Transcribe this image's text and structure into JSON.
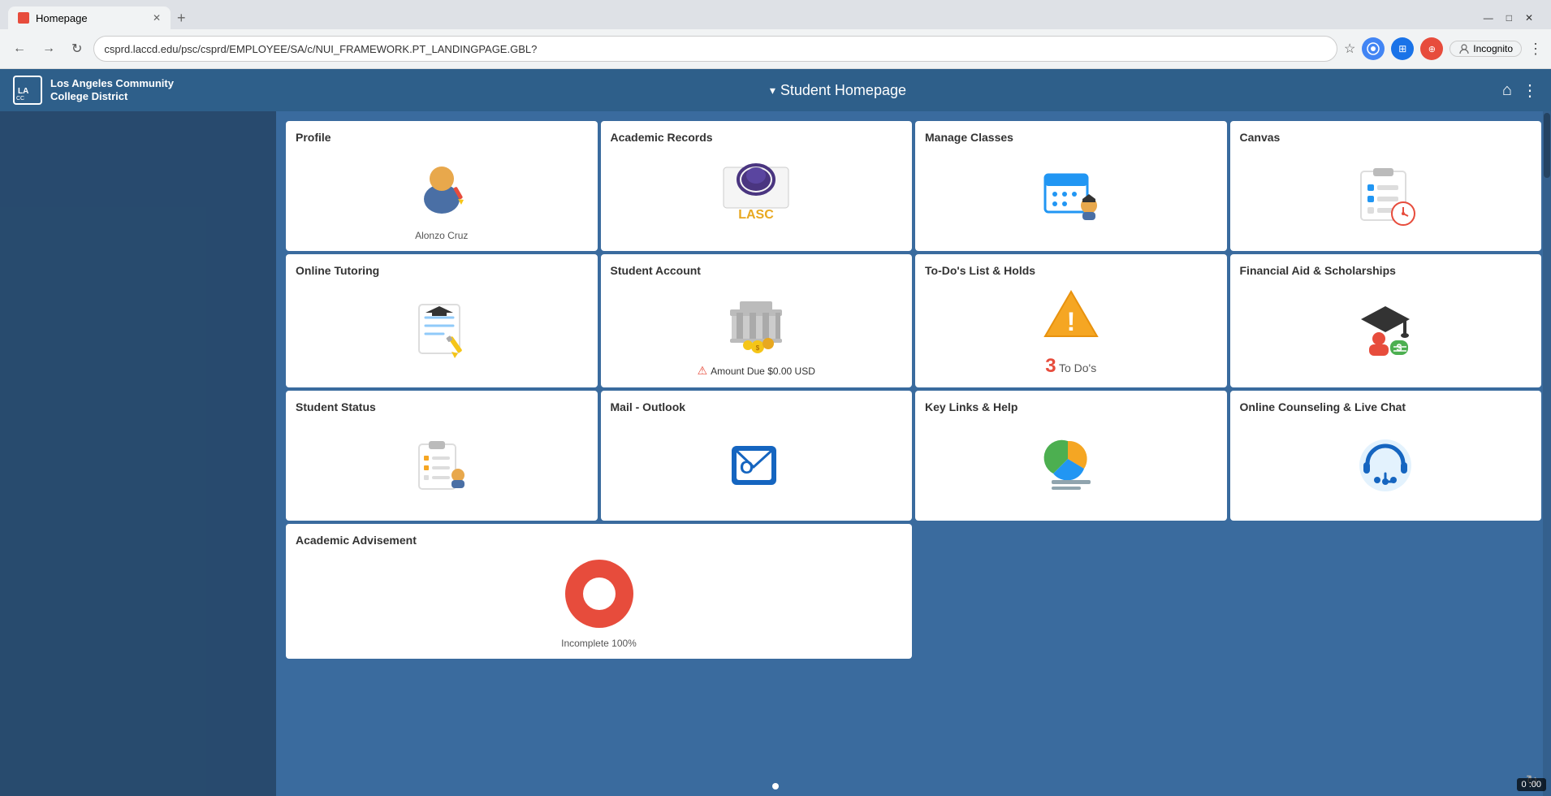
{
  "browser": {
    "tab_label": "Homepage",
    "tab_favicon": "red-square",
    "address_url": "csprd.laccd.edu/psc/csprd/EMPLOYEE/SA/c/NUI_FRAMEWORK.PT_LANDINGPAGE.GBL?",
    "new_tab_label": "+",
    "window_minimize": "—",
    "window_maximize": "□",
    "window_close": "✕",
    "incognito_label": "Incognito",
    "back_btn": "←",
    "forward_btn": "→",
    "refresh_btn": "↻"
  },
  "app_header": {
    "logo_line1": "Los Angeles Community",
    "logo_line2": "College District",
    "title_arrow": "▾",
    "title": "Student Homepage",
    "home_icon": "⌂",
    "menu_icon": "⋮"
  },
  "tiles": [
    {
      "id": "profile",
      "title": "Profile",
      "subtitle": "Alonzo Cruz",
      "icon_type": "profile"
    },
    {
      "id": "academic-records",
      "title": "Academic Records",
      "subtitle": "",
      "icon_type": "lasc"
    },
    {
      "id": "manage-classes",
      "title": "Manage Classes",
      "subtitle": "",
      "icon_type": "calendar"
    },
    {
      "id": "canvas",
      "title": "Canvas",
      "subtitle": "",
      "icon_type": "canvas"
    },
    {
      "id": "online-tutoring",
      "title": "Online Tutoring",
      "subtitle": "",
      "icon_type": "tutoring"
    },
    {
      "id": "student-account",
      "title": "Student Account",
      "subtitle": "Amount Due $0.00 USD",
      "icon_type": "account"
    },
    {
      "id": "todo-list",
      "title": "To-Do's List & Holds",
      "subtitle": "3 To Do's",
      "todo_count": "3",
      "icon_type": "warning"
    },
    {
      "id": "financial-aid",
      "title": "Financial Aid & Scholarships",
      "subtitle": "",
      "icon_type": "financial"
    },
    {
      "id": "student-status",
      "title": "Student Status",
      "subtitle": "",
      "icon_type": "status"
    },
    {
      "id": "mail-outlook",
      "title": "Mail - Outlook",
      "subtitle": "",
      "icon_type": "outlook"
    },
    {
      "id": "key-links",
      "title": "Key Links & Help",
      "subtitle": "",
      "icon_type": "keylinks"
    },
    {
      "id": "online-counseling",
      "title": "Online Counseling & Live Chat",
      "subtitle": "",
      "icon_type": "counseling"
    },
    {
      "id": "academic-advisement",
      "title": "Academic Advisement",
      "subtitle": "Incomplete 100%",
      "icon_type": "advisement",
      "wide": true
    }
  ],
  "amount_due_label": "Amount Due $0.00 USD",
  "todo_count": "3",
  "todo_label": "To Do's",
  "incomplete_label": "Incomplete 100%",
  "time_label": "0 :00",
  "user_name": "Alonzo Cruz"
}
